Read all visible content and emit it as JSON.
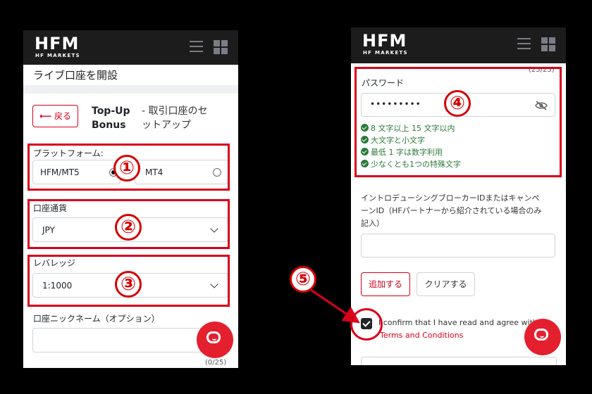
{
  "brand": {
    "logo_main": "HFM",
    "logo_sub": "HF MARKETS"
  },
  "left": {
    "page_title": "ライブ口座を開設",
    "back_label": "戻る",
    "step_title_line1": "Top-Up",
    "step_title_line2": "Bonus",
    "step_sub_line1": "- 取引口座のセ",
    "step_sub_line2": "ットアップ",
    "platform_label": "プラットフォーム:",
    "platform_options": [
      "HFM/MT5",
      "MT4"
    ],
    "currency_label": "口座通貨",
    "currency_value": "JPY",
    "leverage_label": "レバレッジ",
    "leverage_value": "1:1000",
    "nickname_label": "口座ニックネーム（オプション）",
    "nickname_counter": "(0/25)"
  },
  "right": {
    "counter_top": "(25/25)",
    "password_label": "パスワード",
    "password_value": "•••••••••",
    "password_rules": [
      "8 文字以上 15 文字以内",
      "大文字と小文字",
      "最低 1 字は数字利用",
      "少なくとも1つの特殊文字"
    ],
    "ib_label_line1": "イントロデューシングブローカーIDまたはキャンペ",
    "ib_label_line2": "ーンID（HFパートナーから紹介されている場合のみ",
    "ib_label_line3": "記入）",
    "add_button": "追加する",
    "clear_button": "クリアする",
    "confirm_text": "I confirm that I have read and agree with the",
    "terms_link": "Terms and Conditions"
  },
  "annotations": [
    "①",
    "②",
    "③",
    "④",
    "⑤"
  ],
  "colors": {
    "accent_red": "#d9001b",
    "header_bg": "#1c1c1c",
    "success_green": "#2c7a3a"
  }
}
